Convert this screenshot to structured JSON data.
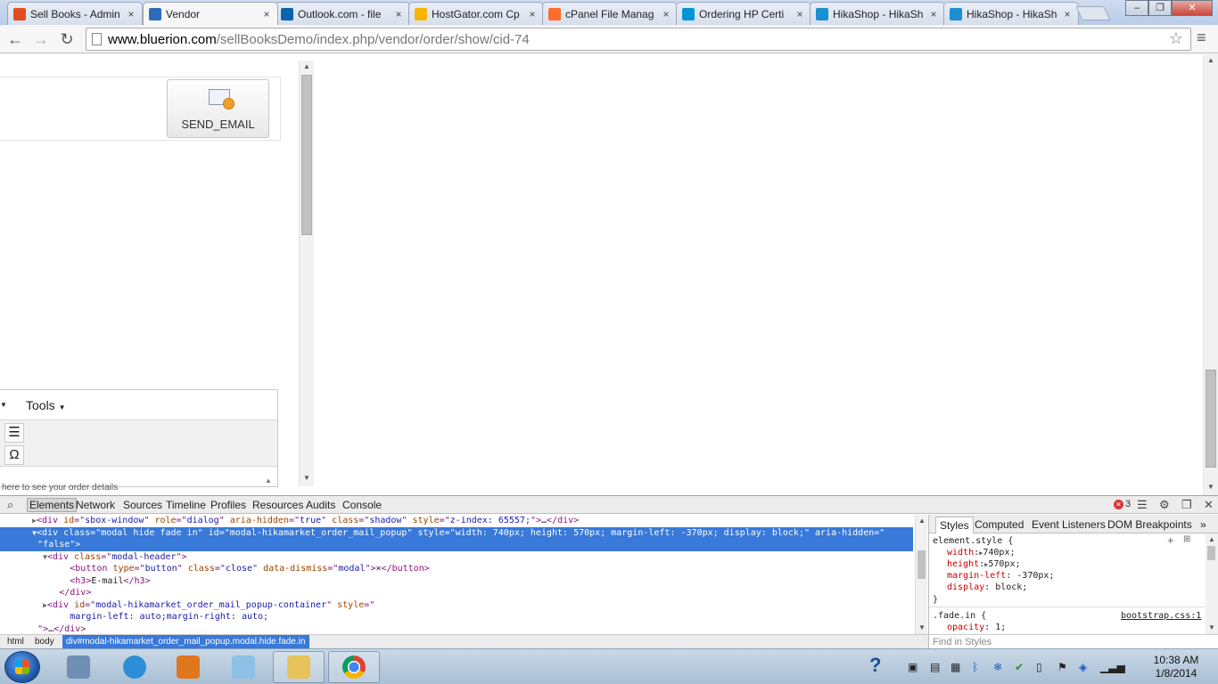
{
  "browser": {
    "tabs": [
      {
        "title": "Sell Books - Admin",
        "favicon": "joomla-icon",
        "color": "#e24c1f"
      },
      {
        "title": "Vendor",
        "favicon": "hikashop-icon",
        "color": "#2a6ebb",
        "active": true
      },
      {
        "title": "Outlook.com - file",
        "favicon": "outlook-icon",
        "color": "#0a64ad"
      },
      {
        "title": "HostGator.com Cp",
        "favicon": "hostgator-icon",
        "color": "#f4b400"
      },
      {
        "title": "cPanel File Manag",
        "favicon": "cpanel-icon",
        "color": "#ff6c2c"
      },
      {
        "title": "Ordering HP Certi",
        "favicon": "hp-icon",
        "color": "#0096d6"
      },
      {
        "title": "HikaShop - HikaSh",
        "favicon": "hikashop-icon",
        "color": "#1b8fd1"
      },
      {
        "title": "HikaShop - HikaSh",
        "favicon": "hikashop-icon",
        "color": "#1b8fd1"
      }
    ],
    "tab_close": "×",
    "url_domain": "www.bluerion.com",
    "url_path": "/sellBooksDemo/index.php/vendor/order/show/cid-74"
  },
  "page": {
    "send_email_label": "SEND_EMAIL",
    "editor_tools_label": "Tools",
    "editor_hint": "here to see your order details"
  },
  "devtools": {
    "tabs": [
      "Elements",
      "Network",
      "Sources",
      "Timeline",
      "Profiles",
      "Resources",
      "Audits",
      "Console"
    ],
    "error_count": "3",
    "lines": [
      {
        "indent": 3,
        "arrow": "▶",
        "html": "<div <a>id</a>=\"<v>sbox-window</v>\" <a>role</a>=\"<v>dialog</v>\" <a>aria-hidden</a>=\"<v>true</v>\" <a>class</a>=\"<v>shadow</v>\" <a>style</a>=\"<v>z-index: 65557;</v>\"><t>…</t></div>"
      },
      {
        "indent": 3,
        "arrow": "▼",
        "sel": true,
        "html": "<div <a>class</a>=\"<v>modal hide fade in</v>\" <a>id</a>=\"<v>modal-hikamarket_order_mail_popup</v>\" <a>style</a>=\"<v>width: 740px; height: 570px; margin-left: -370px; display: block;</v>\" <a>aria-hidden</a>=\""
      },
      {
        "indent": 3,
        "arrow": "",
        "sel": true,
        "html": "\"<v>false</v>\">"
      },
      {
        "indent": 4,
        "arrow": "▼",
        "html": "<div <a>class</a>=\"<v>modal-header</v>\">"
      },
      {
        "indent": 6,
        "arrow": "",
        "html": "<button <a>type</a>=\"<v>button</v>\" <a>class</a>=\"<v>close</v>\" <a>data-dismiss</a>=\"<v>modal</v>\"><t>×</t></button>"
      },
      {
        "indent": 6,
        "arrow": "",
        "html": "<h3><t>E-mail</t></h3>"
      },
      {
        "indent": 5,
        "arrow": "",
        "html": "</div>"
      },
      {
        "indent": 4,
        "arrow": "▶",
        "html": "<div <a>id</a>=\"<v>modal-hikamarket_order_mail_popup-container</v>\" <a>style</a>=\""
      },
      {
        "indent": 6,
        "arrow": "",
        "html": "<v>margin-left: auto;margin-right: auto;</v>"
      },
      {
        "indent": 3,
        "arrow": "",
        "html": "\"><t>…</t></div>"
      }
    ],
    "breadcrumbs": [
      "html",
      "body",
      "div#modal-hikamarket_order_mail_popup.modal.hide.fade.in"
    ],
    "side_tabs": [
      "Styles",
      "Computed",
      "Event Listeners",
      "DOM Breakpoints"
    ],
    "side_more": "»",
    "element_style": {
      "selector": "element.style {",
      "props": [
        {
          "name": "width",
          "value": "740px;",
          "arrow": true
        },
        {
          "name": "height",
          "value": "570px;",
          "arrow": true
        },
        {
          "name": "margin-left",
          "value": "-370px;"
        },
        {
          "name": "display",
          "value": "block;"
        }
      ],
      "close": "}"
    },
    "rule2": {
      "selector": ".fade.in {",
      "source": "bootstrap.css:1",
      "prop": "opacity",
      "value": "1;"
    },
    "find_placeholder": "Find in Styles"
  },
  "taskbar": {
    "apps": [
      {
        "name": "calculator-icon",
        "color": "#6f8fb5"
      },
      {
        "name": "internet-explorer-icon",
        "color": "#2d8ed8"
      },
      {
        "name": "media-player-icon",
        "color": "#e0771f"
      },
      {
        "name": "notepad-icon",
        "color": "#8fc0e6"
      },
      {
        "name": "file-explorer-icon",
        "color": "#e7c35a",
        "pinned": true
      },
      {
        "name": "chrome-icon",
        "color": "#db4437",
        "pinned": true
      }
    ],
    "time": "10:38 AM",
    "date": "1/8/2014"
  }
}
